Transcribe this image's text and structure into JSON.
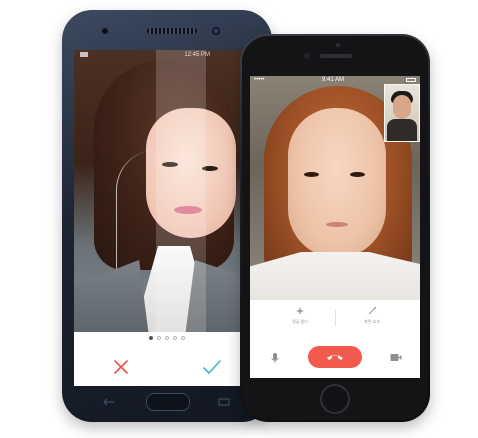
{
  "android": {
    "status": {
      "time": "12:45 PM"
    },
    "pager": {
      "dots": 5,
      "active": 0
    },
    "actions": {
      "reject_icon": "x-icon",
      "accept_icon": "check-icon",
      "reject_color": "#e8534a",
      "accept_color": "#3fb9c9"
    }
  },
  "iphone": {
    "status": {
      "carrier": "•••••",
      "clock": "9:41 AM"
    },
    "controls": {
      "effects_label": "얼굴 필터",
      "filter_label": "화면 효과",
      "end_call_color": "#f25a4e",
      "icons": [
        "sparkle-icon",
        "wand-icon",
        "mic-icon",
        "phone-hangup-icon",
        "video-camera-icon"
      ]
    }
  }
}
